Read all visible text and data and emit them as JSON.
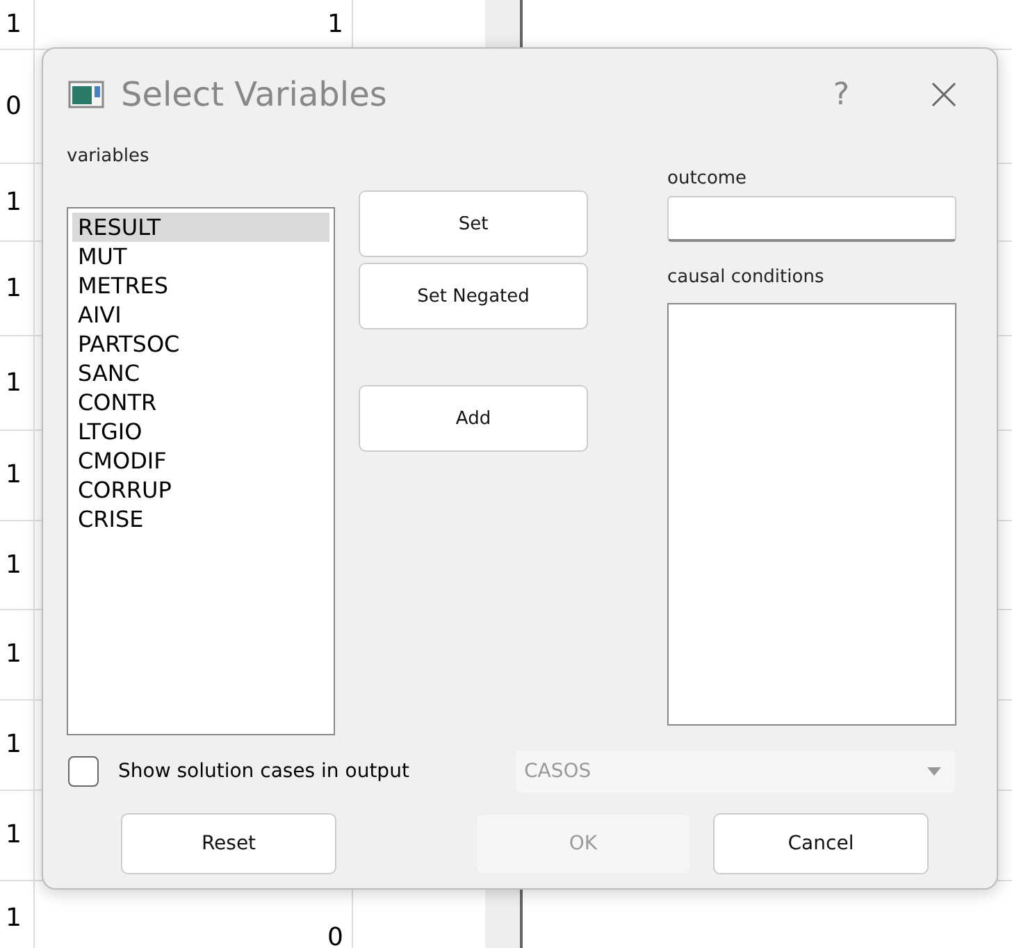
{
  "sheet": {
    "rows": [
      {
        "column_1": "1",
        "column_2": "1"
      },
      {
        "column_1": "0"
      },
      {
        "column_1": "1"
      },
      {
        "column_1": "1"
      },
      {
        "column_1": "1"
      },
      {
        "column_1": "1"
      },
      {
        "column_1": "1"
      },
      {
        "column_1": "1"
      },
      {
        "column_1": "1"
      },
      {
        "column_1": "1"
      },
      {
        "column_1": "1",
        "column_2": "0"
      }
    ]
  },
  "dialog": {
    "title": "Select Variables",
    "help": "?",
    "variables": {
      "label": "variables",
      "items": [
        {
          "name": "RESULT",
          "selected": true
        },
        {
          "name": "MUT",
          "selected": false
        },
        {
          "name": "METRES",
          "selected": false
        },
        {
          "name": "AIVI",
          "selected": false
        },
        {
          "name": "PARTSOC",
          "selected": false
        },
        {
          "name": "SANC",
          "selected": false
        },
        {
          "name": "CONTR",
          "selected": false
        },
        {
          "name": "LTGIO",
          "selected": false
        },
        {
          "name": "CMODIF",
          "selected": false
        },
        {
          "name": "CORRUP",
          "selected": false
        },
        {
          "name": "CRISE",
          "selected": false
        }
      ]
    },
    "actions": [
      {
        "label": "Set"
      },
      {
        "label": "Set Negated"
      },
      {
        "label": "Add"
      }
    ],
    "outcome": {
      "label": "outcome"
    },
    "causal_conditions": {
      "label": "causal conditions"
    },
    "show_cases": {
      "label": "Show solution cases in output",
      "checked": false
    },
    "cases_combo": {
      "value": "CASOS",
      "disabled": true
    },
    "buttons": [
      {
        "label": "Reset",
        "disabled": false
      },
      {
        "label": "OK",
        "disabled": true
      },
      {
        "label": "Cancel",
        "disabled": false
      }
    ]
  }
}
